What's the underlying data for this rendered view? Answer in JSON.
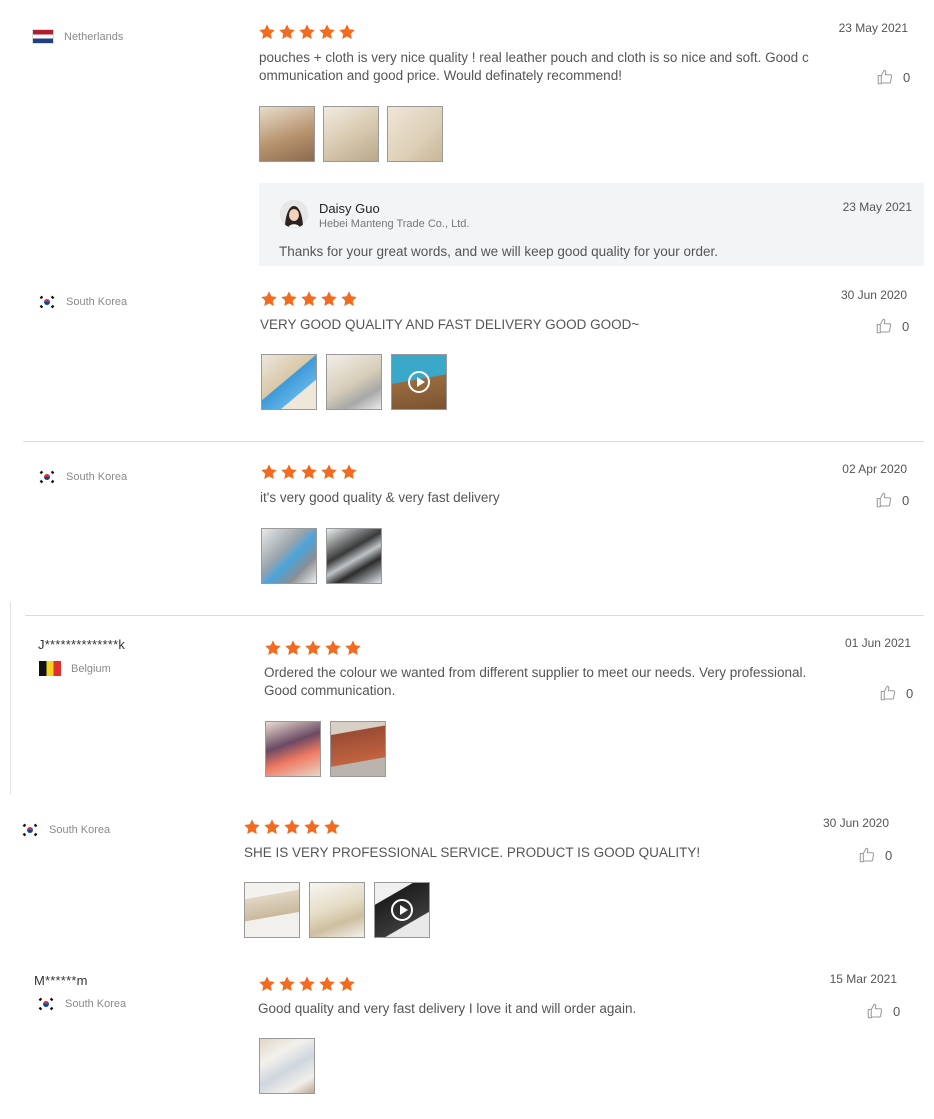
{
  "colors": {
    "star": "#f26b21",
    "text": "#555555",
    "divider": "#dddddd",
    "reply_bg": "#f2f4f6"
  },
  "reviews": [
    {
      "country": "Netherlands",
      "username": "",
      "rating": 5,
      "date": "23 May 2021",
      "text_lines": [
        "pouches + cloth is very nice quality ! real leather pouch and cloth is so nice and soft. Good c",
        "ommunication and good price. Would definately recommend!"
      ],
      "likes": "0",
      "photos": [
        {
          "video": false
        },
        {
          "video": false
        },
        {
          "video": false
        }
      ],
      "reply": {
        "name": "Daisy Guo",
        "company": "Hebei Manteng Trade Co., Ltd.",
        "date": "23 May 2021",
        "text": "Thanks for your great words, and we will keep good quality for your order."
      }
    },
    {
      "country": "South Korea",
      "username": "",
      "rating": 5,
      "date": "30 Jun 2020",
      "text_lines": [
        "VERY GOOD QUALITY AND FAST DELIVERY GOOD GOOD~"
      ],
      "likes": "0",
      "photos": [
        {
          "video": false
        },
        {
          "video": false
        },
        {
          "video": true
        }
      ]
    },
    {
      "country": "South Korea",
      "username": "",
      "rating": 5,
      "date": "02 Apr 2020",
      "text_lines": [
        "it's very good quality & very fast delivery"
      ],
      "likes": "0",
      "photos": [
        {
          "video": false
        },
        {
          "video": false
        }
      ]
    },
    {
      "country": "Belgium",
      "username": "J**************k",
      "rating": 5,
      "date": "01 Jun 2021",
      "text_lines": [
        "Ordered the colour we wanted from different supplier to meet our needs. Very professional.",
        "Good communication."
      ],
      "likes": "0",
      "photos": [
        {
          "video": false
        },
        {
          "video": false
        }
      ]
    },
    {
      "country": "South Korea",
      "username": "",
      "rating": 5,
      "date": "30 Jun 2020",
      "text_lines": [
        "SHE IS VERY PROFESSIONAL SERVICE. PRODUCT IS GOOD QUALITY!"
      ],
      "likes": "0",
      "photos": [
        {
          "video": false
        },
        {
          "video": false
        },
        {
          "video": true
        }
      ]
    },
    {
      "country": "South Korea",
      "username": "M******m",
      "rating": 5,
      "date": "15 Mar 2021",
      "text_lines": [
        "Good quality and very fast delivery  I love it and will order again."
      ],
      "likes": "0",
      "photos": [
        {
          "video": false
        }
      ]
    }
  ]
}
